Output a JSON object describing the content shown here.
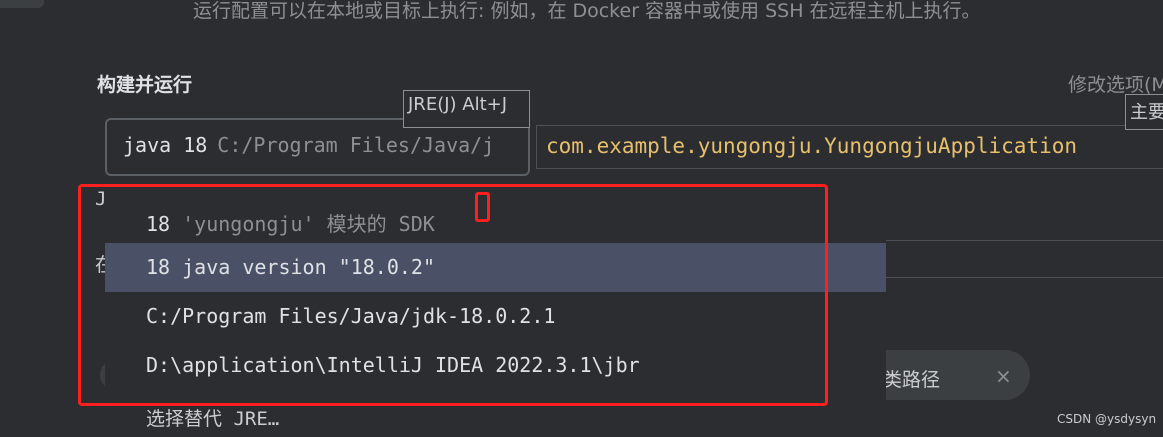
{
  "hint_text": "运行配置可以在本地或目标上执行: 例如，在 Docker 容器中或使用 SSH 在远程主机上执行。",
  "section_title": "构建并运行",
  "modify_options": "修改选项(M",
  "tooltips": {
    "jre_shortcut": "JRE(J) Alt+J",
    "main_class_shortcut": "主要"
  },
  "jre_combo": {
    "version": "java 18",
    "path": "C:/Program Files/Java/j"
  },
  "main_class": {
    "value": "com.example.yungongju.YungongjuApplication"
  },
  "background_labels": {
    "j_partial": "J",
    "other_partial": "在"
  },
  "classpath_chip": {
    "label": "类路径",
    "close": "×"
  },
  "jre_dropdown": {
    "options": [
      {
        "prefix": "18",
        "detail": "'yungongju' 模块的 SDK",
        "selected": false
      },
      {
        "prefix": "18 java version \"18.0.2\"",
        "detail": "",
        "selected": true
      },
      {
        "prefix": "C:/Program Files/Java/jdk-18.0.2.1",
        "detail": "",
        "selected": false
      },
      {
        "prefix": "D:\\application\\IntelliJ IDEA 2022.3.1\\jbr",
        "detail": "",
        "selected": false
      }
    ],
    "choose_alternative": "选择替代 JRE…"
  },
  "watermark": "CSDN @ysdysyn",
  "colors": {
    "background": "#2b2d30",
    "selection": "#4a5166",
    "main_class_text": "#e8c06c",
    "annotation_red": "#ff1f1f"
  }
}
